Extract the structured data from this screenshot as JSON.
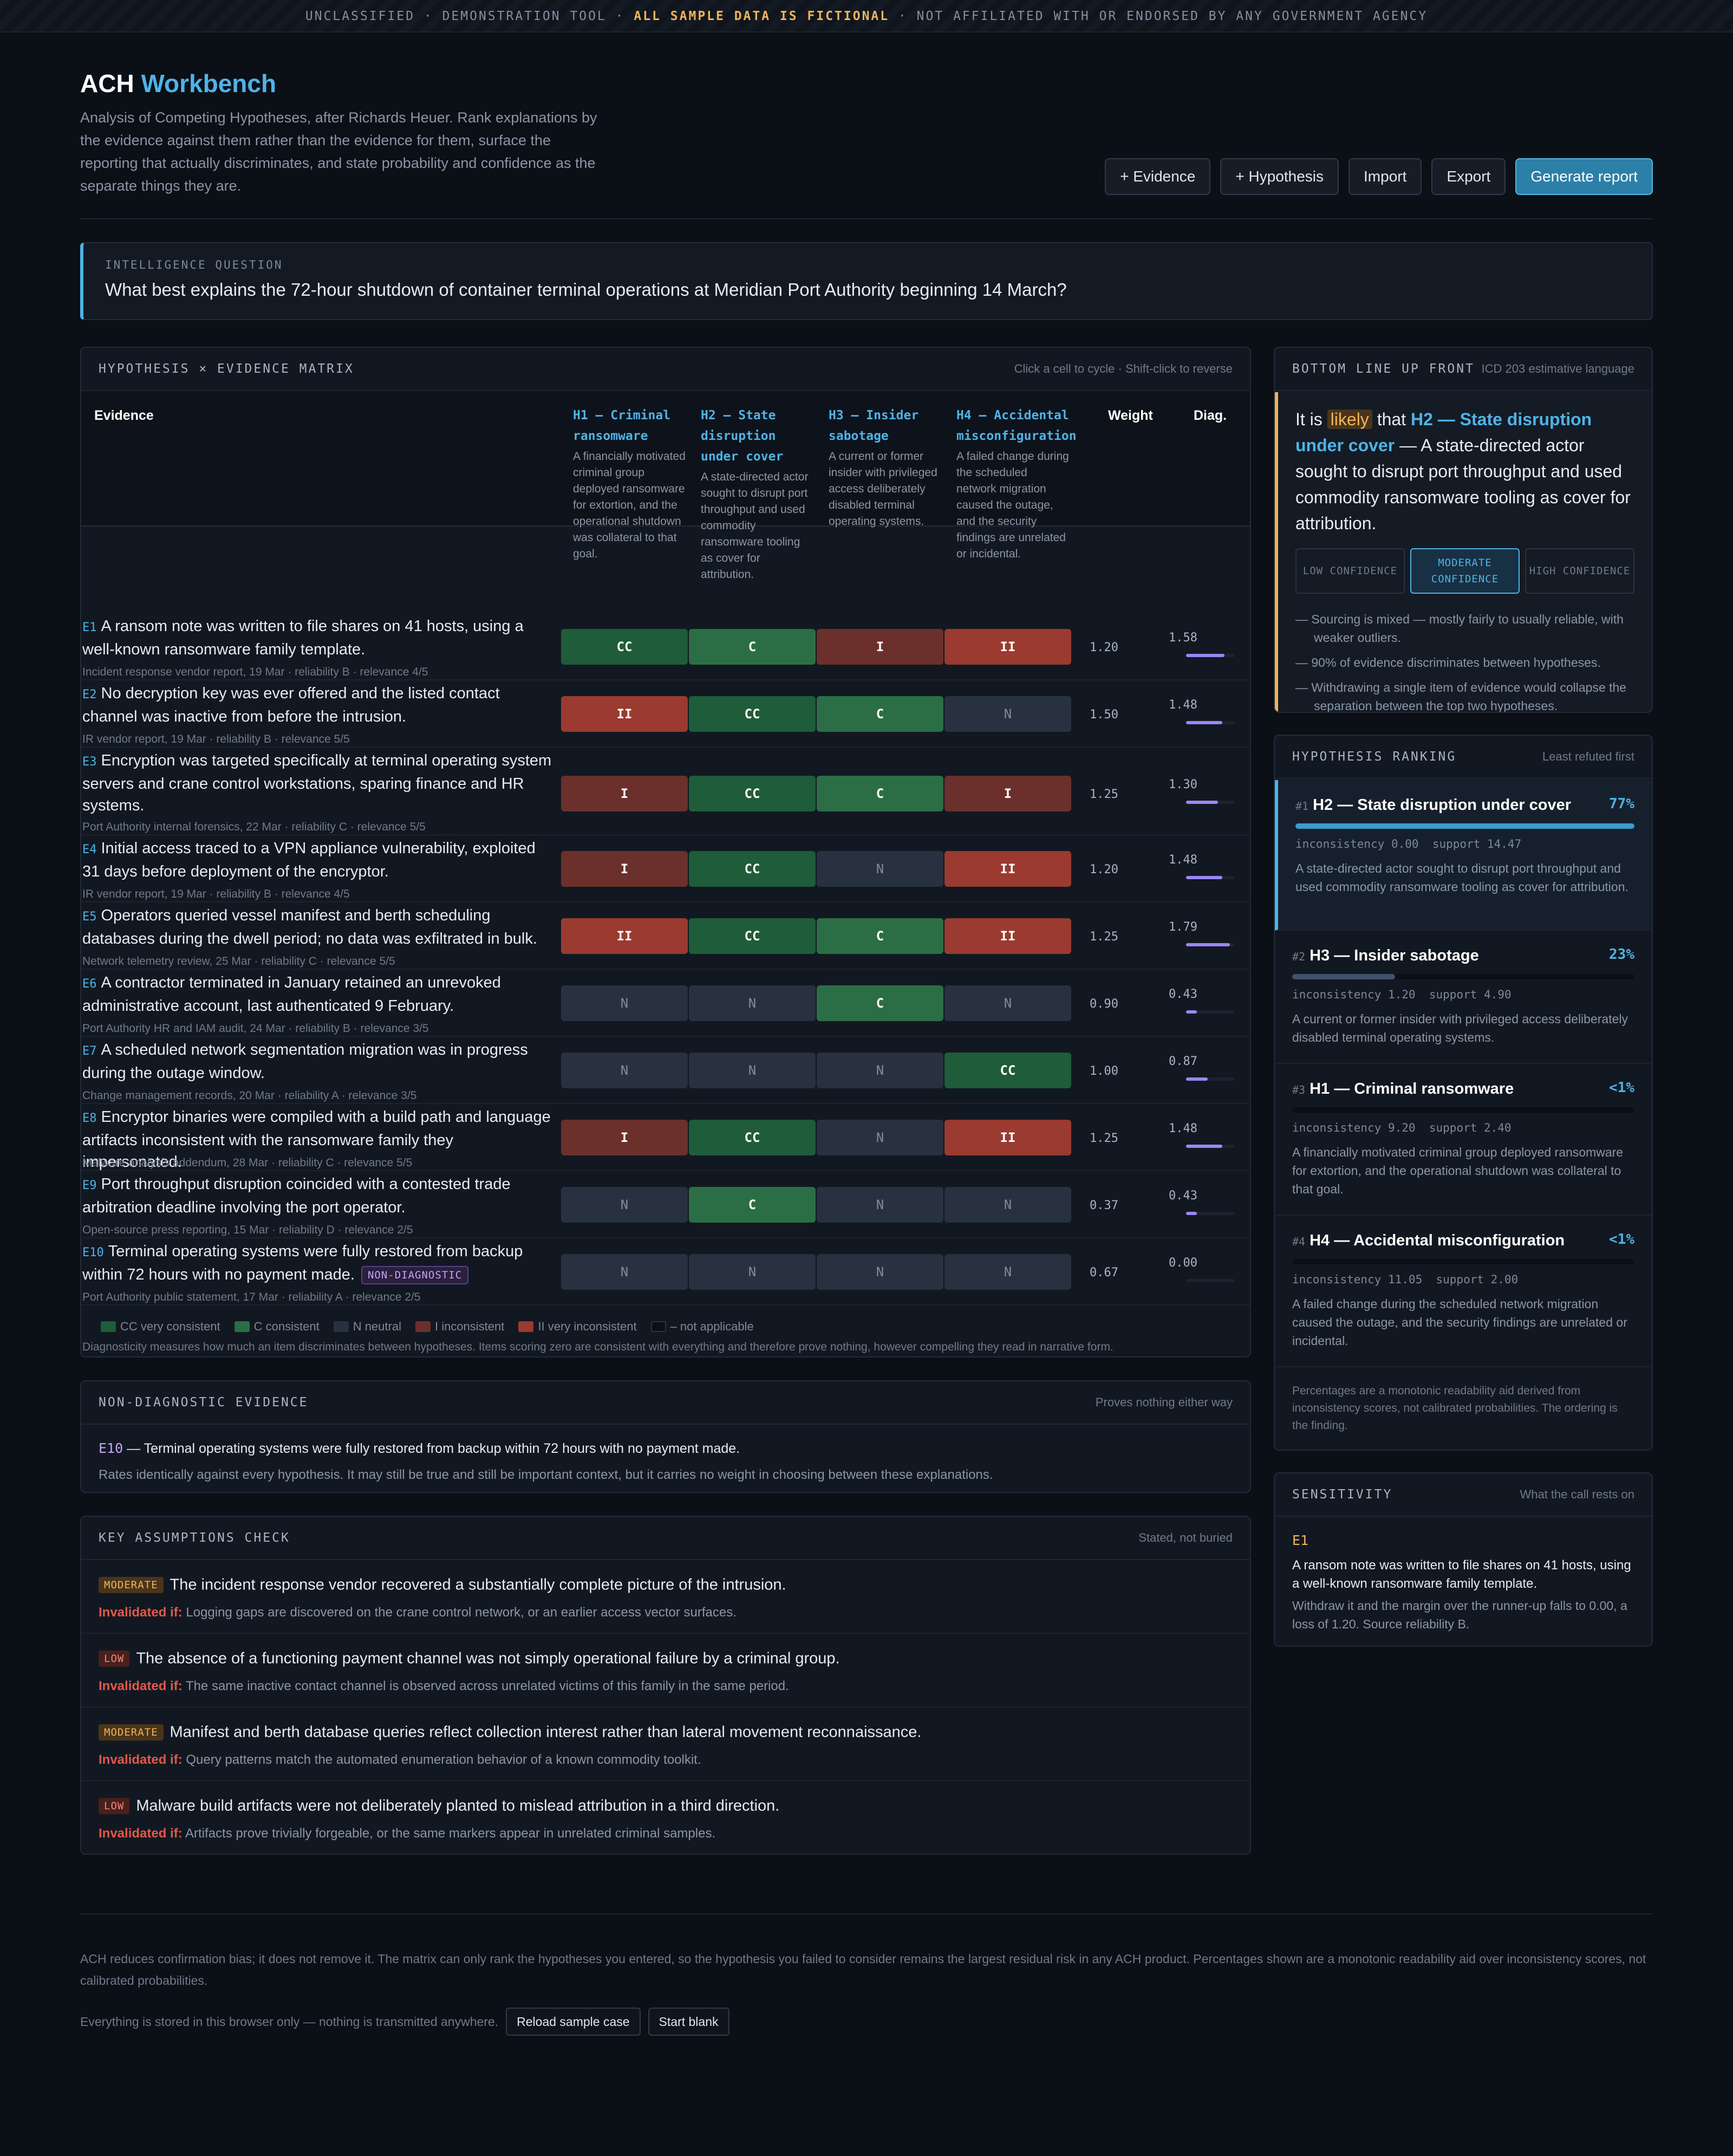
{
  "banner": {
    "pre": "UNCLASSIFIED · DEMONSTRATION TOOL ·",
    "highlight": "ALL SAMPLE DATA IS FICTIONAL",
    "post": "· NOT AFFILIATED WITH OR ENDORSED BY ANY GOVERNMENT AGENCY"
  },
  "app": {
    "title_a": "ACH",
    "title_b": "Workbench",
    "subtitle": "Analysis of Competing Hypotheses, after Richards Heuer. Rank explanations by the evidence against them rather than the evidence for them, surface the reporting that actually discriminates, and state probability and confidence as the separate things they are."
  },
  "toolbar": {
    "evidence": "+ Evidence",
    "hypothesis": "+ Hypothesis",
    "import": "Import",
    "export": "Export",
    "report": "Generate report"
  },
  "question": {
    "label": "INTELLIGENCE QUESTION",
    "text": "What best explains the 72-hour shutdown of container terminal operations at Meridian Port Authority beginning 14 March?"
  },
  "matrix": {
    "title": "HYPOTHESIS × EVIDENCE MATRIX",
    "hint": "Click a cell to cycle · Shift-click to reverse",
    "col_evidence": "Evidence",
    "col_weight": "Weight",
    "col_diag": "Diag.",
    "hypotheses": [
      {
        "name": "H1 — Criminal ransomware",
        "desc": "A financially motivated criminal group deployed ransomware for extortion, and the operational shutdown was collateral to that goal."
      },
      {
        "name": "H2 — State disruption under cover",
        "desc": "A state-directed actor sought to disrupt port throughput and used commodity ransomware tooling as cover for attribution."
      },
      {
        "name": "H3 — Insider sabotage",
        "desc": "A current or former insider with privileged access deliberately disabled terminal operating systems."
      },
      {
        "name": "H4 — Accidental misconfiguration",
        "desc": "A failed change during the scheduled network migration caused the outage, and the security findings are unrelated or incidental."
      }
    ],
    "rows": [
      {
        "id": "E1",
        "text": "A ransom note was written to file shares on 41 hosts, using a well-known ransomware family template.",
        "src": "Incident response vendor report, 19 Mar · reliability B · relevance 4/5",
        "cells": [
          "CC",
          "C",
          "I",
          "II"
        ],
        "weight": "1.20",
        "diag": "1.58",
        "dval": 0.79
      },
      {
        "id": "E2",
        "text": "No decryption key was ever offered and the listed contact channel was inactive from before the intrusion.",
        "src": "IR vendor report, 19 Mar · reliability B · relevance 5/5",
        "cells": [
          "II",
          "CC",
          "C",
          "N"
        ],
        "weight": "1.50",
        "diag": "1.48",
        "dval": 0.74
      },
      {
        "id": "E3",
        "text": "Encryption was targeted specifically at terminal operating system servers and crane control workstations, sparing finance and HR systems.",
        "src": "Port Authority internal forensics, 22 Mar · reliability C · relevance 5/5",
        "cells": [
          "I",
          "CC",
          "C",
          "I"
        ],
        "weight": "1.25",
        "diag": "1.30",
        "dval": 0.65
      },
      {
        "id": "E4",
        "text": "Initial access traced to a VPN appliance vulnerability, exploited 31 days before deployment of the encryptor.",
        "src": "IR vendor report, 19 Mar · reliability B · relevance 4/5",
        "cells": [
          "I",
          "CC",
          "N",
          "II"
        ],
        "weight": "1.20",
        "diag": "1.48",
        "dval": 0.74
      },
      {
        "id": "E5",
        "text": "Operators queried vessel manifest and berth scheduling databases during the dwell period; no data was exfiltrated in bulk.",
        "src": "Network telemetry review, 25 Mar · reliability C · relevance 5/5",
        "cells": [
          "II",
          "CC",
          "C",
          "II"
        ],
        "weight": "1.25",
        "diag": "1.79",
        "dval": 0.9
      },
      {
        "id": "E6",
        "text": "A contractor terminated in January retained an unrevoked administrative account, last authenticated 9 February.",
        "src": "Port Authority HR and IAM audit, 24 Mar · reliability B · relevance 3/5",
        "cells": [
          "N",
          "N",
          "C",
          "N"
        ],
        "weight": "0.90",
        "diag": "0.43",
        "dval": 0.22
      },
      {
        "id": "E7",
        "text": "A scheduled network segmentation migration was in progress during the outage window.",
        "src": "Change management records, 20 Mar · reliability A · relevance 3/5",
        "cells": [
          "N",
          "N",
          "N",
          "CC"
        ],
        "weight": "1.00",
        "diag": "0.87",
        "dval": 0.44
      },
      {
        "id": "E8",
        "text": "Encryptor binaries were compiled with a build path and language artifacts inconsistent with the ransomware family they impersonated.",
        "src": "Malware analysis addendum, 28 Mar · reliability C · relevance 5/5",
        "cells": [
          "I",
          "CC",
          "N",
          "II"
        ],
        "weight": "1.25",
        "diag": "1.48",
        "dval": 0.74
      },
      {
        "id": "E9",
        "text": "Port throughput disruption coincided with a contested trade arbitration deadline involving the port operator.",
        "src": "Open-source press reporting, 15 Mar · reliability D · relevance 2/5",
        "cells": [
          "N",
          "C",
          "N",
          "N"
        ],
        "weight": "0.37",
        "diag": "0.43",
        "dval": 0.22
      },
      {
        "id": "E10",
        "text": "Terminal operating systems were fully restored from backup within 72 hours with no payment made.",
        "tag": "NON-DIAGNOSTIC",
        "src": "Port Authority public statement, 17 Mar · reliability A · relevance 2/5",
        "cells": [
          "N",
          "N",
          "N",
          "N"
        ],
        "weight": "0.67",
        "diag": "0.00",
        "dval": 0
      }
    ],
    "legend": [
      "CC very consistent",
      "C consistent",
      "N neutral",
      "I inconsistent",
      "II very inconsistent",
      "– not applicable"
    ],
    "legend_colors": [
      "#1f5c3a",
      "#2b6e45",
      "#283140",
      "#6b302b",
      "#9a3a30",
      "#0b0f16"
    ],
    "footnote": "Diagnosticity measures how much an item discriminates between hypotheses. Items scoring zero are consistent with everything and therefore prove nothing, however compelling they read in narrative form."
  },
  "nondiag": {
    "title": "NON-DIAGNOSTIC EVIDENCE",
    "note": "Proves nothing either way",
    "id": "E10",
    "text": " — Terminal operating systems were fully restored from backup within 72 hours with no payment made.",
    "sub": "Rates identically against every hypothesis. It may still be true and still be important context, but it carries no weight in choosing between these explanations."
  },
  "assumptions": {
    "title": "KEY ASSUMPTIONS CHECK",
    "note": "Stated, not buried",
    "inv_label": "Invalidated if:",
    "items": [
      {
        "level": "MODERATE",
        "text": "The incident response vendor recovered a substantially complete picture of the intrusion.",
        "inv": "Logging gaps are discovered on the crane control network, or an earlier access vector surfaces."
      },
      {
        "level": "LOW",
        "text": "The absence of a functioning payment channel was not simply operational failure by a criminal group.",
        "inv": "The same inactive contact channel is observed across unrelated victims of this family in the same period."
      },
      {
        "level": "MODERATE",
        "text": "Manifest and berth database queries reflect collection interest rather than lateral movement reconnaissance.",
        "inv": "Query patterns match the automated enumeration behavior of a known commodity toolkit."
      },
      {
        "level": "LOW",
        "text": "Malware build artifacts were not deliberately planted to mislead attribution in a third direction.",
        "inv": "Artifacts prove trivially forgeable, or the same markers appear in unrelated criminal samples."
      }
    ]
  },
  "bluf": {
    "title": "BOTTOM LINE UP FRONT",
    "note": "ICD 203 estimative language",
    "pre": "It is ",
    "likely": "likely",
    "mid": " that ",
    "hyp": "H2 — State disruption under cover",
    "post": " — A state-directed actor sought to disrupt port throughput and used commodity ransomware tooling as cover for attribution.",
    "confidence": [
      "LOW CONFIDENCE",
      "MODERATE CONFIDENCE",
      "HIGH CONFIDENCE"
    ],
    "selected_confidence": 1,
    "bullets": [
      "— Sourcing is mixed — mostly fairly to usually reliable, with weaker outliers.",
      "— 90% of evidence discriminates between hypotheses.",
      "— Withdrawing a single item of evidence would collapse the separation between the top two hypotheses."
    ]
  },
  "ranking": {
    "title": "HYPOTHESIS RANKING",
    "note": "Least refuted first",
    "items": [
      {
        "rank": "#1",
        "name": "H2 — State disruption under cover",
        "pct": "77%",
        "frac": 1.0,
        "stats": "inconsistency 0.00  support 14.47",
        "desc": "A state-directed actor sought to disrupt port throughput and used commodity ransomware tooling as cover for attribution."
      },
      {
        "rank": "#2",
        "name": "H3 — Insider sabotage",
        "pct": "23%",
        "frac": 0.3,
        "stats": "inconsistency 1.20  support 4.90",
        "desc": "A current or former insider with privileged access deliberately disabled terminal operating systems."
      },
      {
        "rank": "#3",
        "name": "H1 — Criminal ransomware",
        "pct": "<1%",
        "frac": 0.0,
        "stats": "inconsistency 9.20  support 2.40",
        "desc": "A financially motivated criminal group deployed ransomware for extortion, and the operational shutdown was collateral to that goal."
      },
      {
        "rank": "#4",
        "name": "H4 — Accidental misconfiguration",
        "pct": "<1%",
        "frac": 0.0,
        "stats": "inconsistency 11.05  support 2.00",
        "desc": "A failed change during the scheduled network migration caused the outage, and the security findings are unrelated or incidental."
      }
    ],
    "footnote": "Percentages are a monotonic readability aid derived from inconsistency scores, not calibrated probabilities. The ordering is the finding."
  },
  "sensitivity": {
    "title": "SENSITIVITY",
    "note": "What the call rests on",
    "id": "E1",
    "text": "A ransom note was written to file shares on 41 hosts, using a well-known ransomware family template.",
    "sub": "Withdraw it and the margin over the runner-up falls to 0.00, a loss of 1.20. Source reliability B."
  },
  "footer": {
    "text": "ACH reduces confirmation bias; it does not remove it. The matrix can only rank the hypotheses you entered, so the hypothesis you failed to consider remains the largest residual risk in any ACH product. Percentages shown are a monotonic readability aid over inconsistency scores, not calibrated probabilities.",
    "storage": "Everything is stored in this browser only — nothing is transmitted anywhere.",
    "reload": "Reload sample case",
    "blank": "Start blank"
  }
}
